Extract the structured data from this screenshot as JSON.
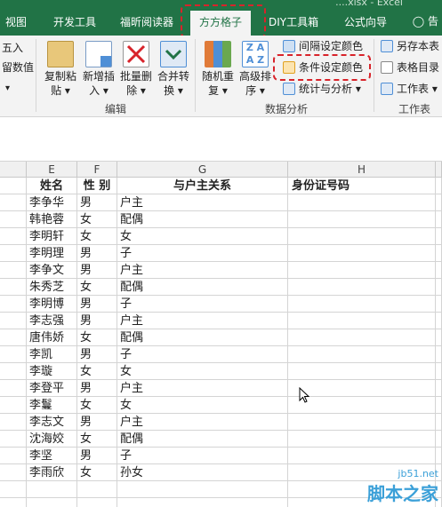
{
  "window": {
    "title_partial": "....xlsx - Excel"
  },
  "tabs": [
    {
      "label": "视图",
      "active": false
    },
    {
      "label": "开发工具",
      "active": false
    },
    {
      "label": "福昕阅读器",
      "active": false
    },
    {
      "label": "方方格子",
      "active": true
    },
    {
      "label": "DIY工具箱",
      "active": false
    },
    {
      "label": "公式向导",
      "active": false
    }
  ],
  "tellme": "告",
  "ribbon": {
    "left_partial": [
      "五入",
      "留数值"
    ],
    "edit_group": {
      "label": "编辑",
      "buttons": [
        {
          "l1": "复制粘",
          "l2": "贴"
        },
        {
          "l1": "新增插",
          "l2": "入"
        },
        {
          "l1": "批量删",
          "l2": "除"
        },
        {
          "l1": "合并转",
          "l2": "换"
        }
      ]
    },
    "analysis_group": {
      "label": "数据分析",
      "buttons": [
        {
          "l1": "随机重",
          "l2": "复"
        },
        {
          "l1": "高级排",
          "l2": "序"
        }
      ],
      "small": [
        "间隔设定颜色",
        "条件设定颜色",
        "统计与分析"
      ]
    },
    "worksheet_group": {
      "label": "工作表",
      "small": [
        "另存本表",
        "表格目录",
        "工作表"
      ]
    }
  },
  "columns": [
    "E",
    "F",
    "G",
    "H"
  ],
  "header_row": [
    "姓名",
    "性 别",
    "与户主关系",
    "身份证号码"
  ],
  "rows": [
    [
      "李争华",
      "男",
      "户主"
    ],
    [
      "韩艳蓉",
      "女",
      "配偶"
    ],
    [
      "李明轩",
      "女",
      "女"
    ],
    [
      "李明理",
      "男",
      "子"
    ],
    [
      "李争文",
      "男",
      "户主"
    ],
    [
      "朱秀芝",
      "女",
      "配偶"
    ],
    [
      "李明博",
      "男",
      "子"
    ],
    [
      "李志强",
      "男",
      "户主"
    ],
    [
      "唐伟娇",
      "女",
      "配偶"
    ],
    [
      "李凯",
      "男",
      "子"
    ],
    [
      "李璇",
      "女",
      "女"
    ],
    [
      "李登平",
      "男",
      "户主"
    ],
    [
      "李鬘",
      "女",
      "女"
    ],
    [
      "李志文",
      "男",
      "户主"
    ],
    [
      "沈海姣",
      "女",
      "配偶"
    ],
    [
      "李坚",
      "男",
      "子"
    ],
    [
      "李雨欣",
      "女",
      "孙女"
    ]
  ],
  "watermark": {
    "site": "jb51.net",
    "name": "脚本之家"
  },
  "colors": {
    "ribbon_green": "#217346",
    "highlight_red": "#d8232a"
  }
}
